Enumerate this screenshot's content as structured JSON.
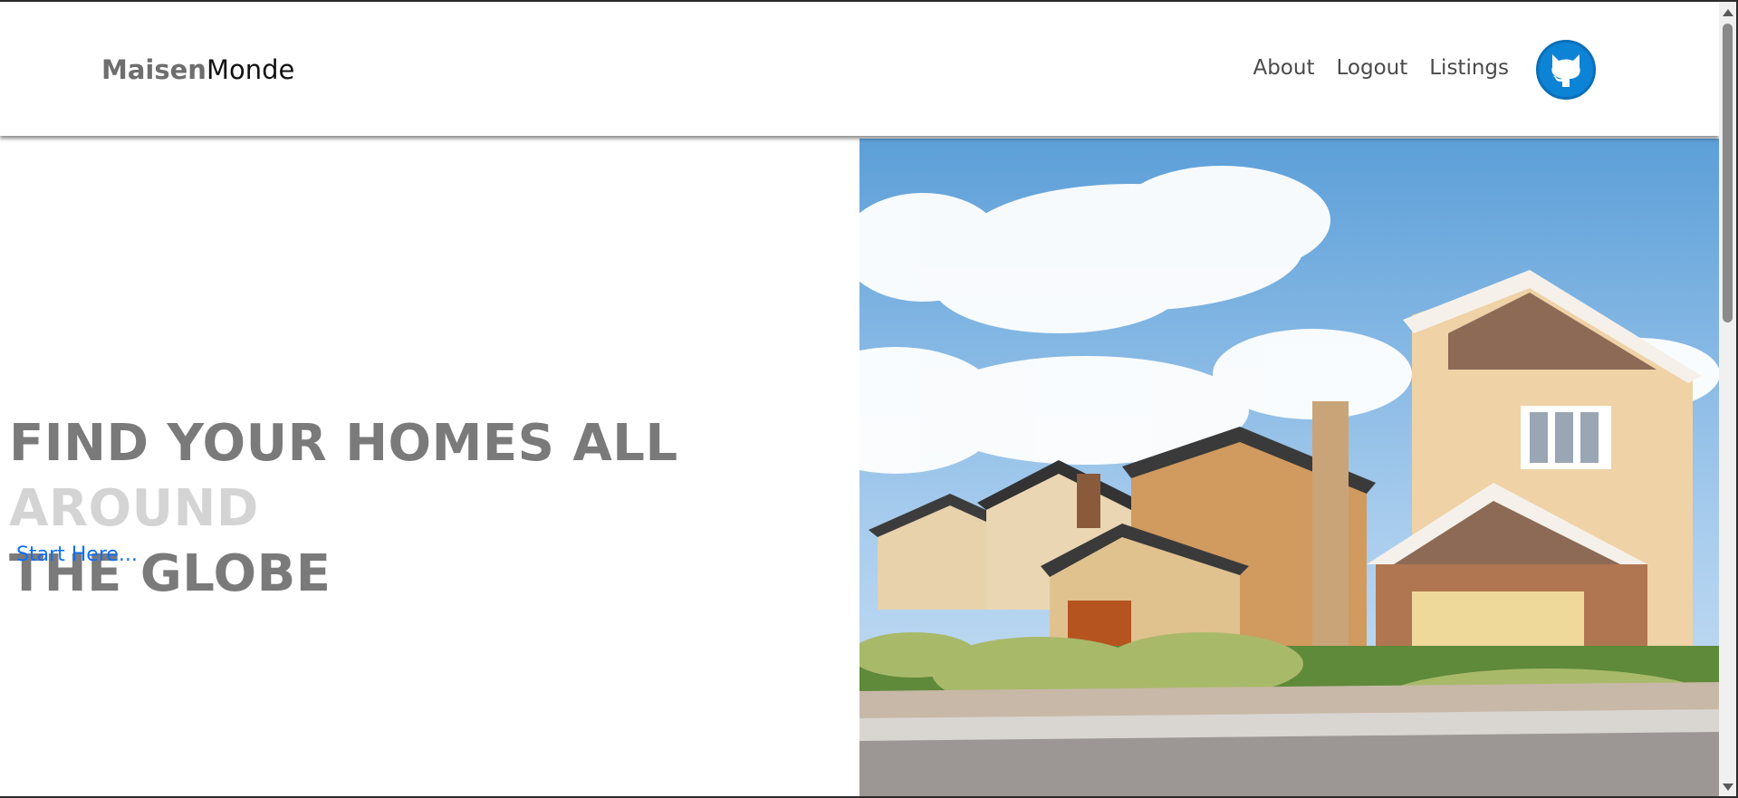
{
  "header": {
    "brand_bold": "Maisen",
    "brand_light": "Monde",
    "nav": [
      {
        "label": "About"
      },
      {
        "label": "Logout"
      },
      {
        "label": "Listings"
      }
    ],
    "github_icon": "github-icon"
  },
  "hero": {
    "title_main": "FIND YOUR HOMES ALL ",
    "title_accent": "AROUND",
    "title_tail": "THE GLOBE",
    "cta_label": "Start Here...",
    "image_icon": "suburban-houses-photo"
  },
  "colors": {
    "accent_blue": "#0d6efd",
    "github_blue": "#0d83d6",
    "title_gray": "#7a7a7a",
    "title_light": "#d4d4d4"
  }
}
